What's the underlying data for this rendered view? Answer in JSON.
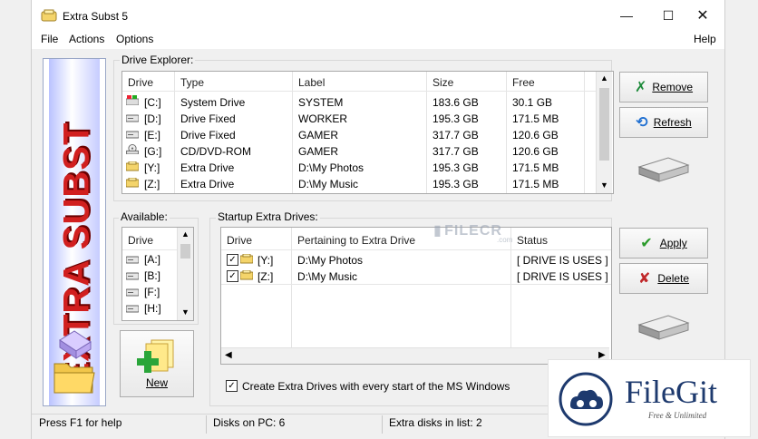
{
  "app": {
    "title": "Extra Subst 5",
    "banner_text": "EXTRA SUBST"
  },
  "menu": [
    "File",
    "Actions",
    "Options"
  ],
  "menu_right": "Help",
  "drive_explorer": {
    "label": "Drive Explorer:",
    "columns": [
      "Drive",
      "Type",
      "Label",
      "Size",
      "Free"
    ],
    "rows": [
      {
        "icon": "windows-drive-icon",
        "drive": "[C:]",
        "type": "System Drive",
        "label": "SYSTEM",
        "size": "183.6 GB",
        "free": "30.1 GB"
      },
      {
        "icon": "hard-drive-icon",
        "drive": "[D:]",
        "type": "Drive Fixed",
        "label": "WORKER",
        "size": "195.3 GB",
        "free": "171.5 MB"
      },
      {
        "icon": "hard-drive-icon",
        "drive": "[E:]",
        "type": "Drive Fixed",
        "label": "GAMER",
        "size": "317.7 GB",
        "free": "120.6 GB"
      },
      {
        "icon": "cd-drive-icon",
        "drive": "[G:]",
        "type": "CD/DVD-ROM",
        "label": "GAMER",
        "size": "317.7 GB",
        "free": "120.6 GB"
      },
      {
        "icon": "extra-drive-icon",
        "drive": "[Y:]",
        "type": "Extra Drive",
        "label": "D:\\My Photos",
        "size": "195.3 GB",
        "free": "171.5 MB"
      },
      {
        "icon": "extra-drive-icon",
        "drive": "[Z:]",
        "type": "Extra Drive",
        "label": "D:\\My Music",
        "size": "195.3 GB",
        "free": "171.5 MB"
      }
    ]
  },
  "buttons": {
    "remove": "Remove",
    "refresh": "Refresh",
    "apply": "Apply",
    "delete": "Delete",
    "new": "New"
  },
  "available": {
    "label": "Available:",
    "column": "Drive",
    "items": [
      "[A:]",
      "[B:]",
      "[F:]",
      "[H:]"
    ]
  },
  "startup": {
    "label": "Startup Extra Drives:",
    "columns": [
      "Drive",
      "Pertaining to Extra Drive",
      "Status"
    ],
    "rows": [
      {
        "drive": "[Y:]",
        "path": "D:\\My Photos",
        "status": "[ DRIVE IS USES ]",
        "checked": true
      },
      {
        "drive": "[Z:]",
        "path": "D:\\My Music",
        "status": "[ DRIVE IS USES ]",
        "checked": true
      }
    ],
    "checkbox_label": "Create Extra Drives with every start of the MS Windows",
    "checkbox_checked": true
  },
  "status_bar": {
    "help": "Press F1 for help",
    "disks": "Disks on PC: 6",
    "extra": "Extra disks in list: 2"
  },
  "watermark": {
    "center": "FILECR",
    "center_sub": ".com",
    "brand": "FileGit",
    "brand_sub": "Free & Unlimited"
  },
  "colors": {
    "accent_red": "#d11f1f",
    "apply_green": "#2a9a2a",
    "delete_red": "#c0282a",
    "brand_navy": "#1e3a6e"
  }
}
